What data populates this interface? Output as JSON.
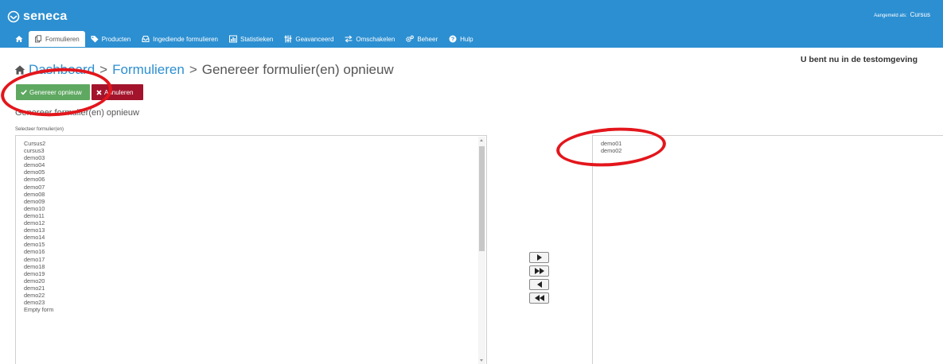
{
  "app": {
    "logo_text": "seneca",
    "logged_in_prefix": "Aangemeld als:",
    "logged_in_user": "Cursus"
  },
  "nav": {
    "items": [
      {
        "label": "",
        "icon": "home-icon"
      },
      {
        "label": "Formulieren",
        "icon": "forms-icon",
        "active": true
      },
      {
        "label": "Producten",
        "icon": "tags-icon"
      },
      {
        "label": "Ingediende formulieren",
        "icon": "inbox-icon"
      },
      {
        "label": "Statistieken",
        "icon": "chart-icon"
      },
      {
        "label": "Geavanceerd",
        "icon": "sliders-icon"
      },
      {
        "label": "Omschakelen",
        "icon": "switch-icon"
      },
      {
        "label": "Beheer",
        "icon": "gears-icon"
      },
      {
        "label": "Hulp",
        "icon": "help-icon"
      }
    ]
  },
  "breadcrumb": {
    "dashboard": "Dashboard",
    "formulieren": "Formulieren",
    "current": "Genereer formulier(en) opnieuw",
    "separator": ">"
  },
  "test_environment_notice": "U bent nu in de testomgeving",
  "actions": {
    "regenerate_label": "Genereer opnieuw",
    "cancel_label": "Annuleren"
  },
  "section_title": "Genereer formulier(en) opnieuw",
  "select_label": "Selecteer formulier(en)",
  "available_forms": [
    "Cursus2",
    "cursus3",
    "demo03",
    "demo04",
    "demo05",
    "demo06",
    "demo07",
    "demo08",
    "demo09",
    "demo10",
    "demo11",
    "demo12",
    "demo13",
    "demo14",
    "demo15",
    "demo16",
    "demo17",
    "demo18",
    "demo19",
    "demo20",
    "demo21",
    "demo22",
    "demo23",
    "Empty form"
  ],
  "selected_forms": [
    "demo01",
    "demo02"
  ],
  "colors": {
    "brand_blue": "#2c8fd1",
    "regenerate_green": "#5fa861",
    "cancel_red": "#a3142c",
    "annotation_red": "#e3161c"
  }
}
